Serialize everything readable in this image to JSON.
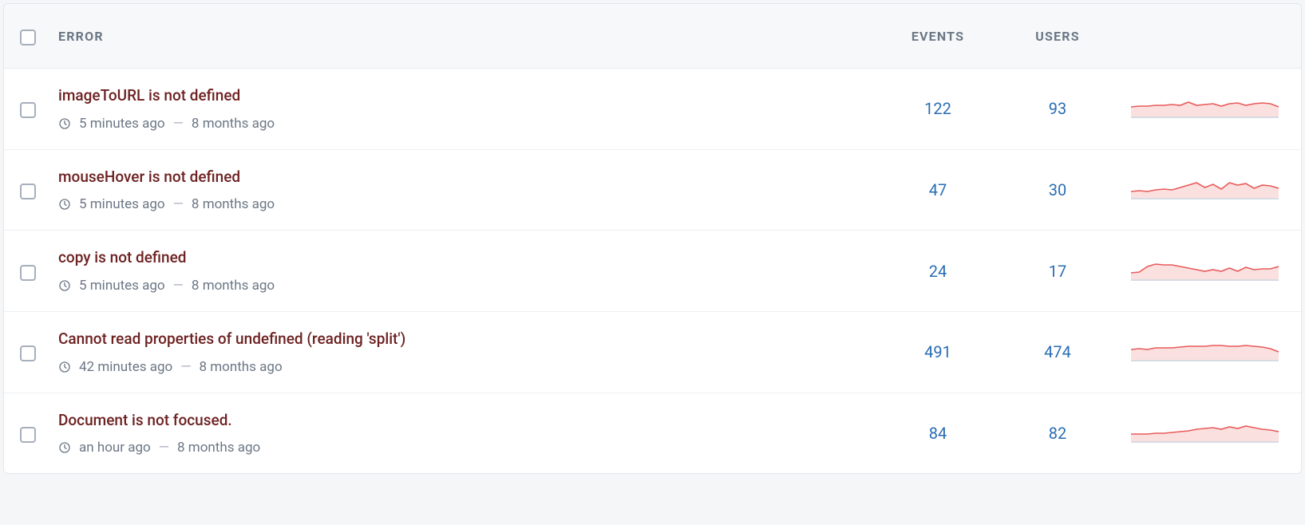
{
  "header": {
    "error_label": "ERROR",
    "events_label": "EVENTS",
    "users_label": "USERS"
  },
  "colors": {
    "link": "#2a6db3",
    "error_title": "#6d2121",
    "spark_stroke": "#e85b5b",
    "spark_fill": "#f7c6c6"
  },
  "rows": [
    {
      "title": "imageToURL is not defined",
      "last_seen": "5 minutes ago",
      "first_seen": "8 months ago",
      "events": "122",
      "users": "93",
      "spark": [
        18,
        17,
        17,
        16,
        16,
        15,
        16,
        12,
        16,
        15,
        14,
        17,
        14,
        13,
        16,
        14,
        13,
        14,
        18
      ]
    },
    {
      "title": "mouseHover is not defined",
      "last_seen": "5 minutes ago",
      "first_seen": "8 months ago",
      "events": "47",
      "users": "30",
      "spark": [
        22,
        21,
        22,
        20,
        19,
        20,
        17,
        14,
        11,
        17,
        13,
        19,
        11,
        14,
        12,
        18,
        14,
        15,
        18
      ]
    },
    {
      "title": "copy is not defined",
      "last_seen": "5 minutes ago",
      "first_seen": "8 months ago",
      "events": "24",
      "users": "17",
      "spark": [
        22,
        21,
        14,
        11,
        12,
        12,
        14,
        16,
        18,
        20,
        18,
        20,
        16,
        20,
        15,
        18,
        17,
        17,
        14
      ]
    },
    {
      "title": "Cannot read properties of undefined (reading 'split')",
      "last_seen": "42 minutes ago",
      "first_seen": "8 months ago",
      "events": "491",
      "users": "474",
      "spark": [
        17,
        16,
        17,
        15,
        15,
        15,
        14,
        13,
        13,
        13,
        12,
        12,
        13,
        13,
        12,
        13,
        14,
        16,
        20
      ]
    },
    {
      "title": "Document is not focused.",
      "last_seen": "an hour ago",
      "first_seen": "8 months ago",
      "events": "84",
      "users": "82",
      "spark": [
        21,
        21,
        21,
        20,
        20,
        19,
        18,
        17,
        15,
        14,
        13,
        15,
        12,
        14,
        11,
        13,
        15,
        16,
        18
      ]
    }
  ]
}
